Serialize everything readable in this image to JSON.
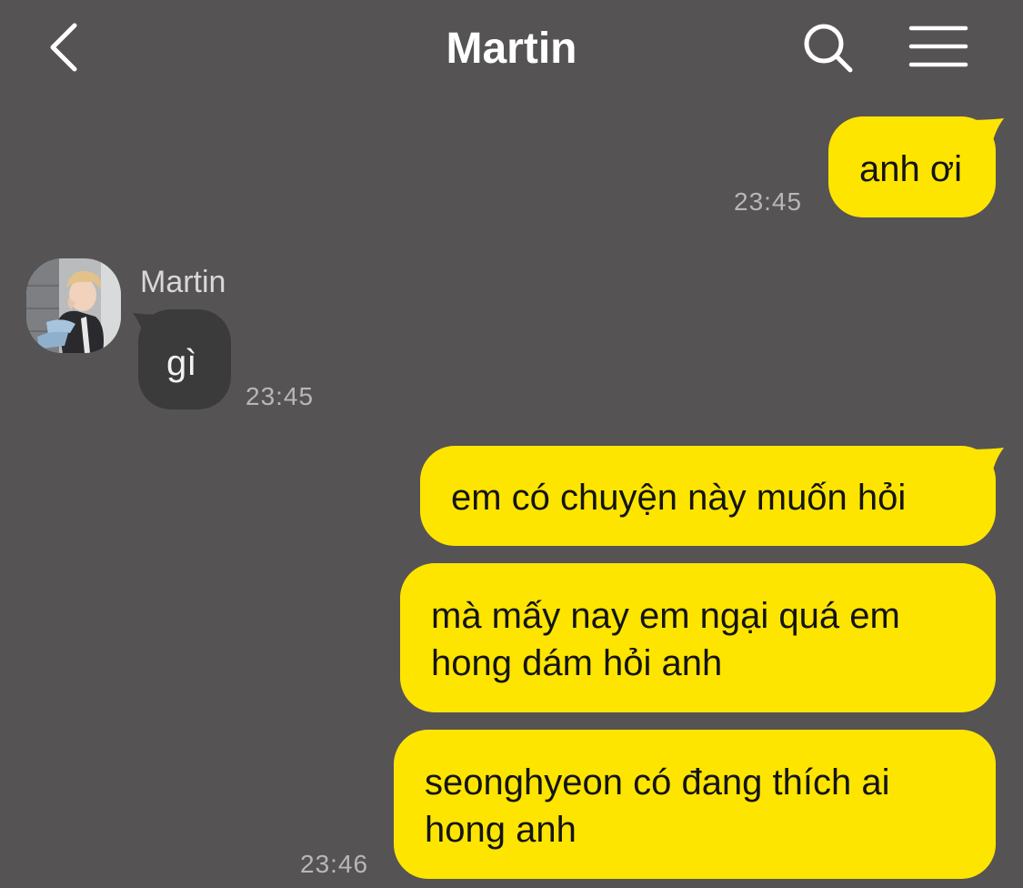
{
  "header": {
    "title": "Martin",
    "back_icon": "chevron-left-icon",
    "search_icon": "search-icon",
    "menu_icon": "hamburger-menu-icon"
  },
  "colors": {
    "background": "#555354",
    "my_bubble": "#fee500",
    "their_bubble": "#3b3b3c",
    "timestamp": "#b7b7b7"
  },
  "messages": [
    {
      "sender": "me",
      "text": "anh ơi",
      "time": "23:45"
    },
    {
      "sender": "Martin",
      "sender_name": "Martin",
      "text": "gì",
      "time": "23:45"
    },
    {
      "sender": "me",
      "text": "em có chuyện này muốn hỏi"
    },
    {
      "sender": "me",
      "lines": [
        "mà mấy nay em ngại quá em",
        "hong dám hỏi anh"
      ]
    },
    {
      "sender": "me",
      "lines": [
        "seonghyeon có đang thích ai",
        "hong anh"
      ],
      "time": "23:46"
    }
  ]
}
